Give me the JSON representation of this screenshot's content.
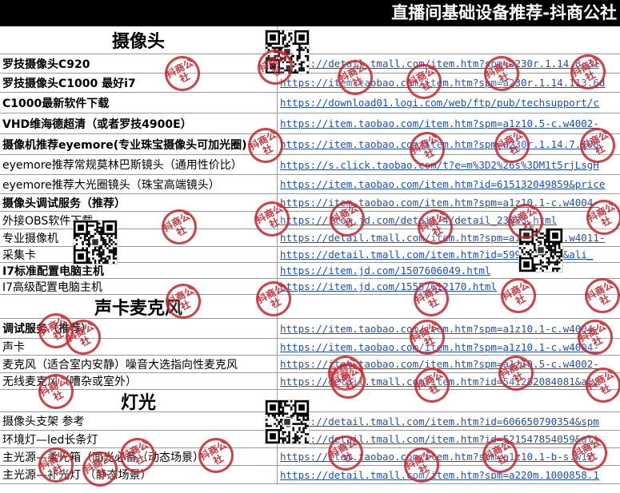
{
  "title": "直播间基础设备推荐-抖商公社",
  "watermark_text": "抖商公社",
  "colors": {
    "title_bar": "#000000",
    "link": "#1f4fbf",
    "stamp": "#cd1e28"
  },
  "sections": [
    {
      "header": "摄像头",
      "rows": [
        {
          "name": "罗技摄像头C920",
          "bold": true,
          "url": "https://detail.tmall.com/item.htm?spm=a230r.1.14.8.31"
        },
        {
          "name": "罗技摄像头C1000 最好i7",
          "bold": true,
          "url": "https://item.taobao.com/item.htm?spm=a230r.1.14.113.6d"
        },
        {
          "name": "C1000最新软件下载",
          "bold": true,
          "url": "https://download01.logi.com/web/ftp/pub/techsupport/c"
        },
        {
          "name": "VHD维海德超清（或者罗技4900E）",
          "bold": true,
          "url": "https://item.taobao.com/item.htm?spm=a1z10.5-c.w4002-"
        },
        {
          "name": "摄像机推荐eyemore(专业珠宝摄像头可加光圈)",
          "bold": true,
          "url": "https://item.taobao.com/item.htm?spm=a230r.1.14.7.108"
        },
        {
          "name": "eyemore推荐常规莫林巴斯镜头（通用性价比）",
          "bold": false,
          "url": "https://s.click.taobao.com/t?e=m%3D2%26s%3DM1t5rjLsgH"
        },
        {
          "name": "eyemore推荐大光圈镜头（珠宝高端镜头）",
          "bold": false,
          "url": "https://item.taobao.com/item.htm?id=615132049859&price"
        },
        {
          "name": "摄像头调试服务（推荐）",
          "bold": true,
          "url": "https://item.taobao.com/item.htm?spm=a1z10.1-c.w4004-"
        },
        {
          "name": "外接OBS软件下载",
          "bold": false,
          "url": "https://item.jd.com/detail/4/detail_23033.html"
        },
        {
          "name": "专业摄像机",
          "bold": false,
          "url": "https://detail.tmall.com/item.htm?spm=a1z10.3-b.w4011-"
        },
        {
          "name": "采集卡",
          "bold": false,
          "url": "https://detail.tmall.com/item.htm?id=5993931753&ali_"
        },
        {
          "name": "I7标准配置电脑主机",
          "bold": true,
          "url": "https://item.jd.com/1507606049.html"
        },
        {
          "name": "I7高级配置电脑主机",
          "bold": false,
          "url": "https://item.jd.com/15557612170.html"
        }
      ]
    },
    {
      "header": "声卡麦克风",
      "rows": [
        {
          "name": "调试服务（推荐）",
          "bold": true,
          "url": "https://item.taobao.com/item.htm?spm=a1z10.1-c.w4004-"
        },
        {
          "name": "声卡",
          "bold": false,
          "url": "https://item.taobao.com/item.htm?spm=a1z10.1-c.w4004-"
        },
        {
          "name": "麦克风（适合室内安静）噪音大选指向性麦克风",
          "bold": false,
          "url": "https://item.taobao.com/item.htm?spm=a1z10.5-c.w4002-"
        },
        {
          "name": "无线麦克风（嘈杂或室外）",
          "bold": false,
          "url": "https://detail.tmall.com/item.htm?id=541282084081&ali"
        }
      ]
    },
    {
      "header": "灯光",
      "rows": [
        {
          "name": "摄像头支架 参考",
          "bold": false,
          "url": "https://detail.tmall.com/item.htm?id=606650790354&spm"
        },
        {
          "name": "环境灯—led长条灯",
          "bold": false,
          "url": "https://detail.tmall.com/item.htm?id=521547854059&ali"
        },
        {
          "name": "主光源—柔光箱（面光必备（动态场景）",
          "bold": false,
          "url": "https://item.taobao.com/item.htm?spm=a1z10.1-b-s.w17"
        },
        {
          "name": "主光源—补光灯 （静态场景）",
          "bold": false,
          "url": "https://detail.tmall.com/item.htm?spm=a220m.1000858.1"
        }
      ]
    }
  ]
}
